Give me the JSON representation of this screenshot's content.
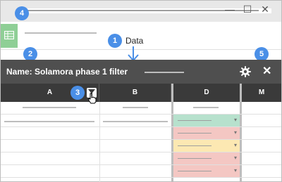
{
  "window": {
    "controls": {
      "minimize": "—",
      "maximize": "☐",
      "close": "✕"
    }
  },
  "callouts": {
    "c1": "1",
    "c2": "2",
    "c3": "3",
    "c4": "4",
    "c5": "5",
    "data_label": "Data"
  },
  "filter_view": {
    "name_label": "Name: Solamora phase 1 filter",
    "close_glyph": "✕"
  },
  "columns": [
    {
      "label": "A"
    },
    {
      "label": "B"
    },
    {
      "label": "D"
    },
    {
      "label": "M"
    }
  ],
  "colored_cells": {
    "colors": [
      "#b7e1cd",
      "#f4c7c3",
      "#fce8b2",
      "#f4c7c3",
      "#f4c7c3"
    ],
    "caret": "▾"
  },
  "colors": {
    "filter_bar": "#4f4f4f",
    "header": "#3a3a3a",
    "callout": "#4a8fe7",
    "sheets_logo": "#8fcf96"
  }
}
